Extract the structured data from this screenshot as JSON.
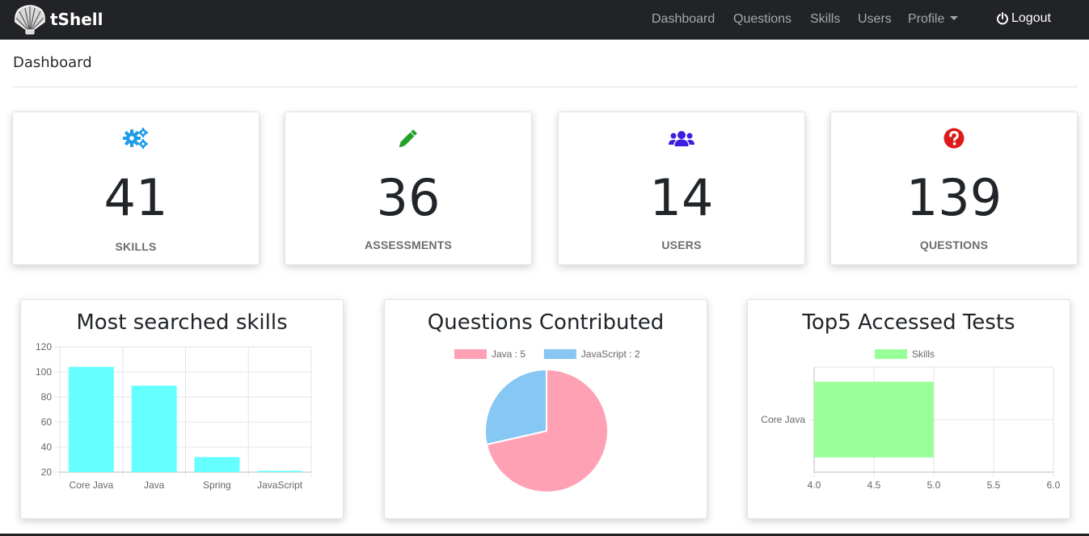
{
  "navbar": {
    "brand": "tShell",
    "links": [
      "Dashboard",
      "Questions",
      "Skills",
      "Users",
      "Profile"
    ],
    "logout": "Logout"
  },
  "page": {
    "title": "Dashboard"
  },
  "stats": [
    {
      "value": "41",
      "label": "SKILLS",
      "icon": "gears-icon",
      "color": "#1e9be9"
    },
    {
      "value": "36",
      "label": "ASSESSMENTS",
      "icon": "pencil-icon",
      "color": "#22a02c"
    },
    {
      "value": "14",
      "label": "USERS",
      "icon": "users-icon",
      "color": "#3d1ee0"
    },
    {
      "value": "139",
      "label": "QUESTIONS",
      "icon": "question-circle-icon",
      "color": "#dc1a1a"
    }
  ],
  "chart_data": [
    {
      "type": "bar",
      "title": "Most searched skills",
      "categories": [
        "Core Java",
        "Java",
        "Spring",
        "JavaScript"
      ],
      "values": [
        104,
        89,
        32,
        21
      ],
      "ylim": [
        20,
        120
      ],
      "yticks": [
        "120",
        "100",
        "80",
        "60",
        "40",
        "20"
      ],
      "color": "#66ffff",
      "grid": true
    },
    {
      "type": "pie",
      "title": "Questions Contributed",
      "labels": [
        "Java : 5",
        "JavaScript : 2"
      ],
      "values": [
        5,
        2
      ],
      "colors": [
        "#ffa1b5",
        "#86c7f3"
      ],
      "legend": "top"
    },
    {
      "type": "bar",
      "orientation": "horizontal",
      "title": "Top5 Accessed Tests",
      "categories": [
        "Core Java"
      ],
      "series": [
        {
          "name": "Skills",
          "values": [
            5
          ]
        }
      ],
      "xlim": [
        4.0,
        6.0
      ],
      "xticks": [
        "4.0",
        "4.5",
        "5.0",
        "5.5",
        "6.0"
      ],
      "color": "#99ff99",
      "legend": "top",
      "grid": true
    }
  ]
}
